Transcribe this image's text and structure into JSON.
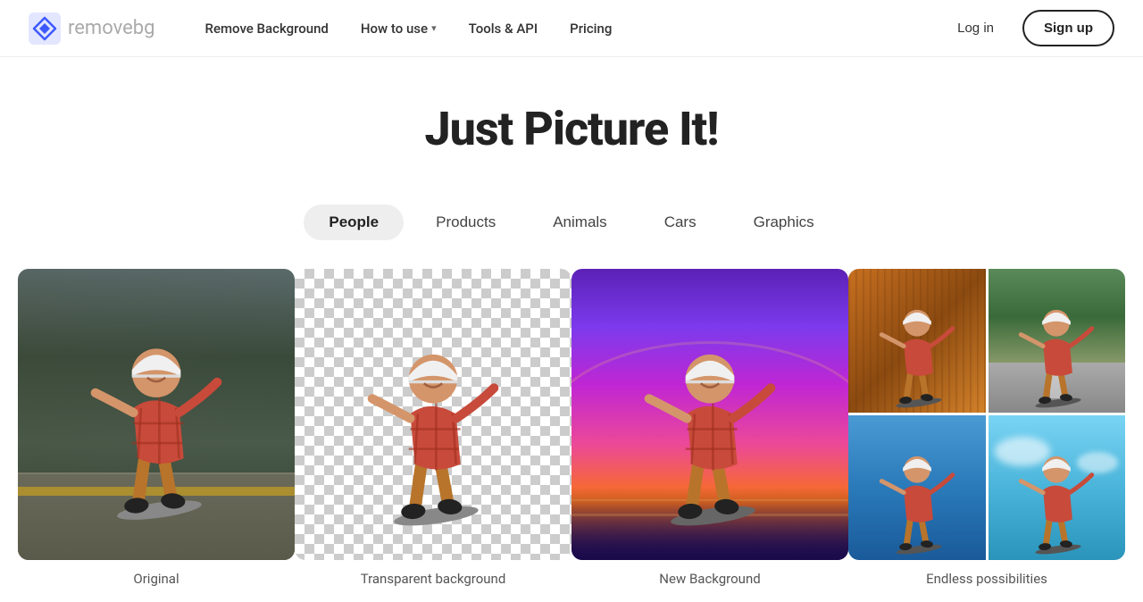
{
  "nav": {
    "logo_text_main": "remove",
    "logo_text_accent": "bg",
    "links": [
      {
        "id": "remove-bg",
        "label": "Remove Background",
        "has_chevron": false
      },
      {
        "id": "how-to-use",
        "label": "How to use",
        "has_chevron": true
      },
      {
        "id": "tools-api",
        "label": "Tools & API",
        "has_chevron": false
      },
      {
        "id": "pricing",
        "label": "Pricing",
        "has_chevron": false
      }
    ],
    "login_label": "Log in",
    "signup_label": "Sign up"
  },
  "hero": {
    "title": "Just Picture It!"
  },
  "tabs": [
    {
      "id": "people",
      "label": "People",
      "active": true
    },
    {
      "id": "products",
      "label": "Products",
      "active": false
    },
    {
      "id": "animals",
      "label": "Animals",
      "active": false
    },
    {
      "id": "cars",
      "label": "Cars",
      "active": false
    },
    {
      "id": "graphics",
      "label": "Graphics",
      "active": false
    }
  ],
  "gallery": [
    {
      "id": "original",
      "label": "Original",
      "type": "original"
    },
    {
      "id": "transparent",
      "label": "Transparent background",
      "type": "transparent"
    },
    {
      "id": "new-bg",
      "label": "New Background",
      "type": "new-bg"
    },
    {
      "id": "endless",
      "label": "Endless possibilities",
      "type": "endless"
    }
  ],
  "colors": {
    "accent": "#222222",
    "tab_active_bg": "#eeeeee",
    "signup_border": "#222222"
  }
}
